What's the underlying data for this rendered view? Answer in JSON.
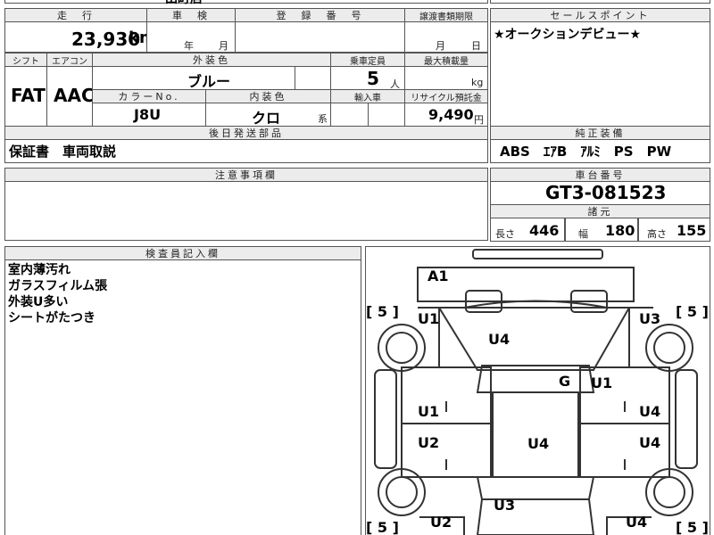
{
  "top_strip": {
    "partial_text": "田町店"
  },
  "mileage": {
    "header": "走　行",
    "value": "23,930",
    "unit": "km"
  },
  "inspection": {
    "header": "車　検",
    "year_unit": "年",
    "month_unit": "月"
  },
  "registration": {
    "header": "登　録　番　号"
  },
  "transfer_deadline": {
    "header": "譲渡書類期限",
    "month_unit": "月",
    "day_unit": "日"
  },
  "sales_point": {
    "header": "セールスポイント",
    "text": "★オークションデビュー★"
  },
  "shift": {
    "header": "シフト",
    "value": "FAT"
  },
  "aircon": {
    "header": "エアコン",
    "value": "AAC"
  },
  "exterior_color": {
    "header": "外装色",
    "value": "ブルー"
  },
  "capacity": {
    "header": "乗車定員",
    "value": "5",
    "unit": "人"
  },
  "max_load": {
    "header": "最大積載量",
    "unit": "kg"
  },
  "color_no": {
    "header": "カラーNo.",
    "value": "J8U"
  },
  "interior_color": {
    "header": "内装色",
    "value": "クロ",
    "suffix": "系"
  },
  "import": {
    "header": "輸入車"
  },
  "recycle": {
    "header": "リサイクル預託金",
    "value": "9,490",
    "unit": "円"
  },
  "later_parts": {
    "header": "後日発送部品",
    "text": "保証書　車両取説"
  },
  "equipment": {
    "header": "純正装備",
    "text": "ABS　ｴｱB　ｱﾙﾐ　PS　PW"
  },
  "caution": {
    "header": "注意事項欄"
  },
  "chassis": {
    "header": "車台番号",
    "value": "GT3-081523"
  },
  "dimensions": {
    "header": "諸元",
    "length_label": "長さ",
    "length": "446",
    "width_label": "幅",
    "width": "180",
    "height_label": "高さ",
    "height": "155"
  },
  "inspector": {
    "header": "検査員記入欄",
    "notes": [
      "室内薄汚れ",
      "ガラスフィルム張",
      "外装U多い",
      "シートがたつき"
    ]
  },
  "diagram": {
    "labels": {
      "front": "A1",
      "tire_fl": "[ 5 ]",
      "tire_fr": "[ 5 ]",
      "tire_rl": "[ 5 ]",
      "tire_rr": "[ 5 ]",
      "fender_l": "U1",
      "fender_r": "U3",
      "hood": "U4",
      "windshield": "G",
      "windshield_damage": "U1",
      "front_door_l": "U1",
      "front_door_r": "U4",
      "rear_door_l": "U2",
      "rear_door_r": "U4",
      "roof": "U4",
      "trunk": "U3",
      "rear_l": "U2",
      "rear_r": "U4"
    }
  }
}
